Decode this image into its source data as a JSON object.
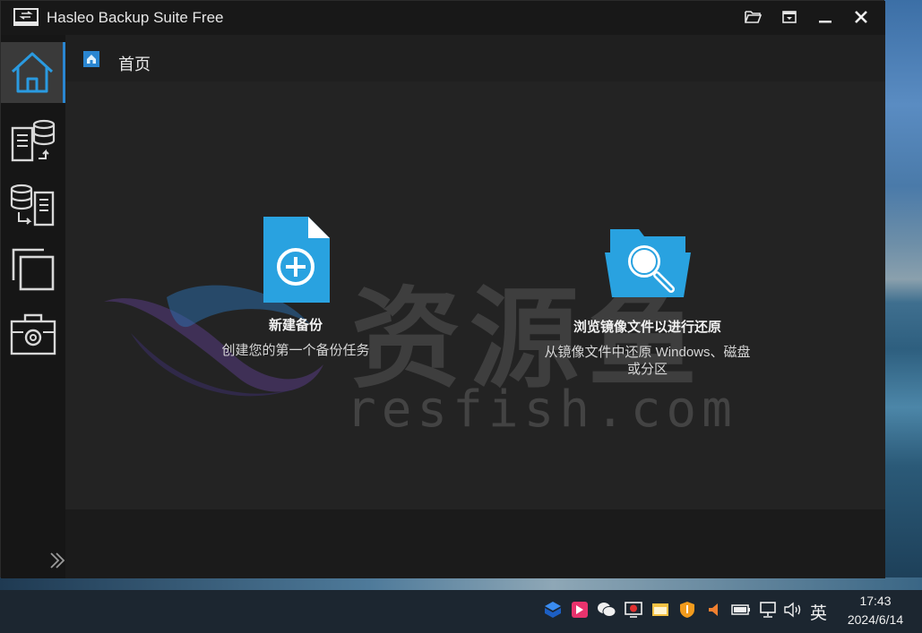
{
  "window": {
    "title": "Hasleo Backup Suite Free"
  },
  "titlebar_buttons": [
    "open-folder-icon",
    "dropdown-menu-icon",
    "minimize-icon",
    "close-icon"
  ],
  "sidebar": {
    "items": [
      {
        "name": "home",
        "icon": "home-icon",
        "active": true
      },
      {
        "name": "backup",
        "icon": "backup-icon",
        "active": false
      },
      {
        "name": "restore",
        "icon": "restore-icon",
        "active": false
      },
      {
        "name": "clone",
        "icon": "clone-icon",
        "active": false
      },
      {
        "name": "tools",
        "icon": "toolbox-icon",
        "active": false
      }
    ],
    "expand_icon": "double-chevron-right-icon"
  },
  "breadcrumb": {
    "label": "首页",
    "icon": "home-icon"
  },
  "actions": {
    "new_backup": {
      "title": "新建备份",
      "desc": "创建您的第一个备份任务"
    },
    "browse_image": {
      "title": "浏览镜像文件以进行还原",
      "desc_line1": "从镜像文件中还原 Windows、磁盘",
      "desc_line2": "或分区"
    }
  },
  "watermark": {
    "cn": "资源鱼",
    "en": "resfish.com"
  },
  "taskbar": {
    "tray_icons": [
      "dropbox-icon",
      "app-pink-icon",
      "wechat-icon",
      "screen-record-icon",
      "window-icon",
      "shield-icon",
      "volume-alert-icon",
      "battery-icon",
      "network-icon",
      "speaker-icon"
    ],
    "ime": "英",
    "time": "17:43",
    "date": "2024/6/14"
  },
  "colors": {
    "accent": "#2a86d1",
    "icon_blue": "#29a2e0"
  }
}
